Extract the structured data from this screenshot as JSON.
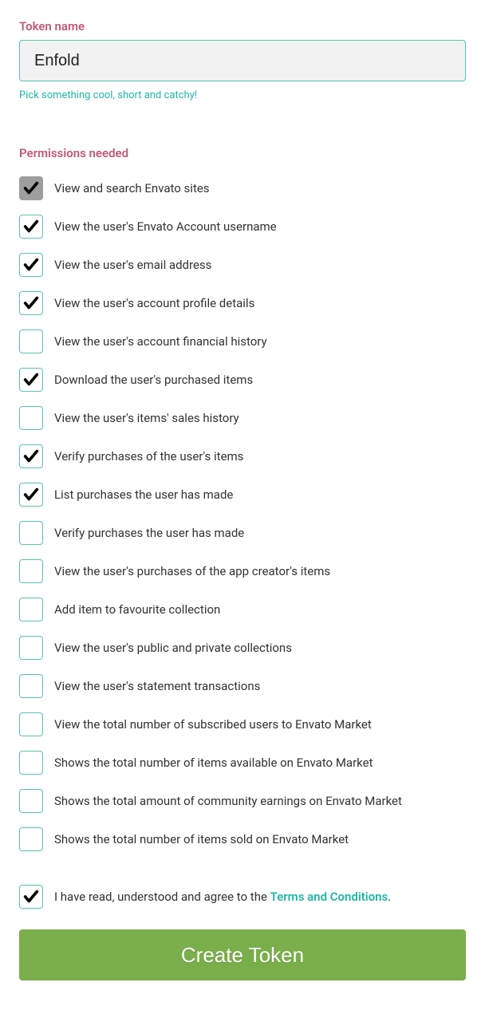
{
  "token_name": {
    "label": "Token name",
    "value": "Enfold",
    "helper": "Pick something cool, short and catchy!"
  },
  "permissions": {
    "label": "Permissions needed",
    "items": [
      {
        "label": "View and search Envato sites",
        "checked": true,
        "locked": true
      },
      {
        "label": "View the user's Envato Account username",
        "checked": true,
        "locked": false
      },
      {
        "label": "View the user's email address",
        "checked": true,
        "locked": false
      },
      {
        "label": "View the user's account profile details",
        "checked": true,
        "locked": false
      },
      {
        "label": "View the user's account financial history",
        "checked": false,
        "locked": false
      },
      {
        "label": "Download the user's purchased items",
        "checked": true,
        "locked": false
      },
      {
        "label": "View the user's items' sales history",
        "checked": false,
        "locked": false
      },
      {
        "label": "Verify purchases of the user's items",
        "checked": true,
        "locked": false
      },
      {
        "label": "List purchases the user has made",
        "checked": true,
        "locked": false
      },
      {
        "label": "Verify purchases the user has made",
        "checked": false,
        "locked": false
      },
      {
        "label": "View the user's purchases of the app creator's items",
        "checked": false,
        "locked": false
      },
      {
        "label": "Add item to favourite collection",
        "checked": false,
        "locked": false
      },
      {
        "label": "View the user's public and private collections",
        "checked": false,
        "locked": false
      },
      {
        "label": "View the user's statement transactions",
        "checked": false,
        "locked": false
      },
      {
        "label": "View the total number of subscribed users to Envato Market",
        "checked": false,
        "locked": false
      },
      {
        "label": "Shows the total number of items available on Envato Market",
        "checked": false,
        "locked": false
      },
      {
        "label": "Shows the total amount of community earnings on Envato Market",
        "checked": false,
        "locked": false
      },
      {
        "label": "Shows the total number of items sold on Envato Market",
        "checked": false,
        "locked": false
      }
    ]
  },
  "terms": {
    "prefix": "I have read, understood and agree to the ",
    "link_text": "Terms and Conditions",
    "suffix": ".",
    "checked": true
  },
  "submit_label": "Create Token"
}
